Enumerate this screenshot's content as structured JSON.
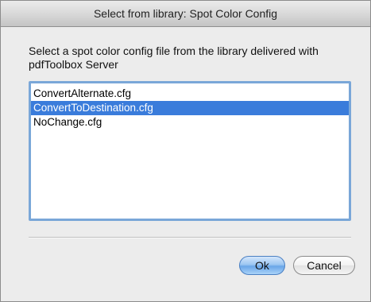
{
  "window": {
    "title": "Select from library: Spot Color Config"
  },
  "instruction": "Select a spot color config file from the library delivered with pdfToolbox Server",
  "list": {
    "items": [
      {
        "label": "ConvertAlternate.cfg",
        "selected": false
      },
      {
        "label": "ConvertToDestination.cfg",
        "selected": true
      },
      {
        "label": "NoChange.cfg",
        "selected": false
      }
    ],
    "selection_color": "#3a7cdb"
  },
  "buttons": {
    "ok_label": "Ok",
    "cancel_label": "Cancel"
  }
}
